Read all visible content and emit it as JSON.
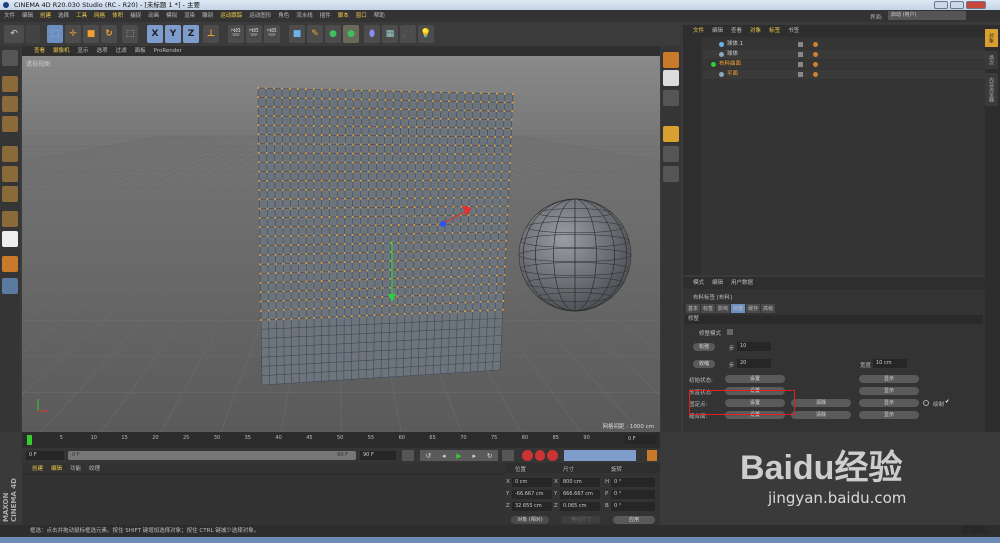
{
  "window": {
    "title": "CINEMA 4D R20.030 Studio (RC - R20) - [未标题 1 *] - 主要"
  },
  "menu": [
    "文件",
    "编辑",
    "创建",
    "选择",
    "工具",
    "网格",
    "体积",
    "捕捉",
    "动画",
    "模拟",
    "渲染",
    "雕刻",
    "运动跟踪",
    "运动图形",
    "角色",
    "流水线",
    "插件",
    "脚本",
    "窗口",
    "帮助"
  ],
  "menu_highlight": [
    2,
    4,
    5,
    6,
    12,
    17,
    18
  ],
  "toolbar": {
    "axis_x": "X",
    "axis_y": "Y",
    "axis_z": "Z"
  },
  "viewport": {
    "menu": [
      "查看",
      "摄像机",
      "显示",
      "选项",
      "过滤",
      "面板",
      "ProRender"
    ],
    "view_name": "透视视图",
    "grid_spacing": "网格间距 : 1000 cm"
  },
  "layout": {
    "label": "界面:",
    "value": "启动 (用户)"
  },
  "object_manager": {
    "tabs": [
      "文件",
      "编辑",
      "查看",
      "对象",
      "标签",
      "书签"
    ],
    "objects": [
      {
        "name": "球体.1",
        "indent": 1
      },
      {
        "name": "球体",
        "indent": 1
      },
      {
        "name": "布料曲面",
        "indent": 0
      },
      {
        "name": "平面",
        "indent": 1
      }
    ]
  },
  "right_tabs": [
    "对象",
    "场次",
    "内容浏览器"
  ],
  "attributes": {
    "menu": [
      "模式",
      "编辑",
      "用户数据"
    ],
    "object": "布料标签 [布料]",
    "tabs": [
      "基本",
      "标签",
      "影响",
      "修整",
      "缓存",
      "高级"
    ],
    "active_tab": 3,
    "section": "修整",
    "dress_mode": "修整模式",
    "relax_btn": "松弛",
    "relax_step_label": "步",
    "relax_step": "10",
    "shrink_btn": "收缩",
    "shrink_step_label": "步",
    "shrink_step": "20",
    "width_label": "宽度",
    "width": "10 cm",
    "rows": [
      {
        "label": "初始状态:",
        "set": "设置",
        "clear": "",
        "show": "显示"
      },
      {
        "label": "放置状态:",
        "set": "设置",
        "clear": "",
        "show": "显示"
      },
      {
        "label": "固定点:",
        "set": "设置",
        "clear": "清除",
        "show": "显示",
        "draw": "绘制"
      },
      {
        "label": "缝合面:",
        "set": "设置",
        "clear": "清除",
        "show": "显示"
      }
    ]
  },
  "timeline": {
    "ticks": [
      "0",
      "5",
      "10",
      "15",
      "20",
      "25",
      "30",
      "35",
      "40",
      "45",
      "50",
      "55",
      "60",
      "65",
      "70",
      "75",
      "80",
      "85",
      "90"
    ],
    "current": "0 F",
    "start": "0 F",
    "range_start": "0 F",
    "range_end": "90 F",
    "end": "90 F"
  },
  "materials": {
    "menu": [
      "创建",
      "编辑",
      "功能",
      "纹理"
    ]
  },
  "coords": {
    "headers": [
      "位置",
      "尺寸",
      "旋转"
    ],
    "rows": [
      {
        "a": "X",
        "pos": "0 cm",
        "b": "X",
        "size": "800 cm",
        "c": "H",
        "rot": "0 °"
      },
      {
        "a": "Y",
        "pos": "-66.667 cm",
        "b": "Y",
        "size": "666.667 cm",
        "c": "P",
        "rot": "0 °"
      },
      {
        "a": "Z",
        "pos": "32.655 cm",
        "b": "Z",
        "size": "0.065 cm",
        "c": "B",
        "rot": "0 °"
      }
    ],
    "mode": "对象 (相对)",
    "size_mode": "绝对尺寸",
    "apply": "应用"
  },
  "brand": "MAXON CINEMA 4D",
  "status": "框选：点击并拖动鼠标框选元素。按住 SHIFT 键增加选择对象；按住 CTRL 键减少选择对象。",
  "watermark": {
    "text": "Baidu经验",
    "url": "jingyan.baidu.com",
    "author": "聪聪AL"
  },
  "colors": {
    "accent": "#f2c94c",
    "highlight_box": "#e02020",
    "points": "#f0a030"
  }
}
